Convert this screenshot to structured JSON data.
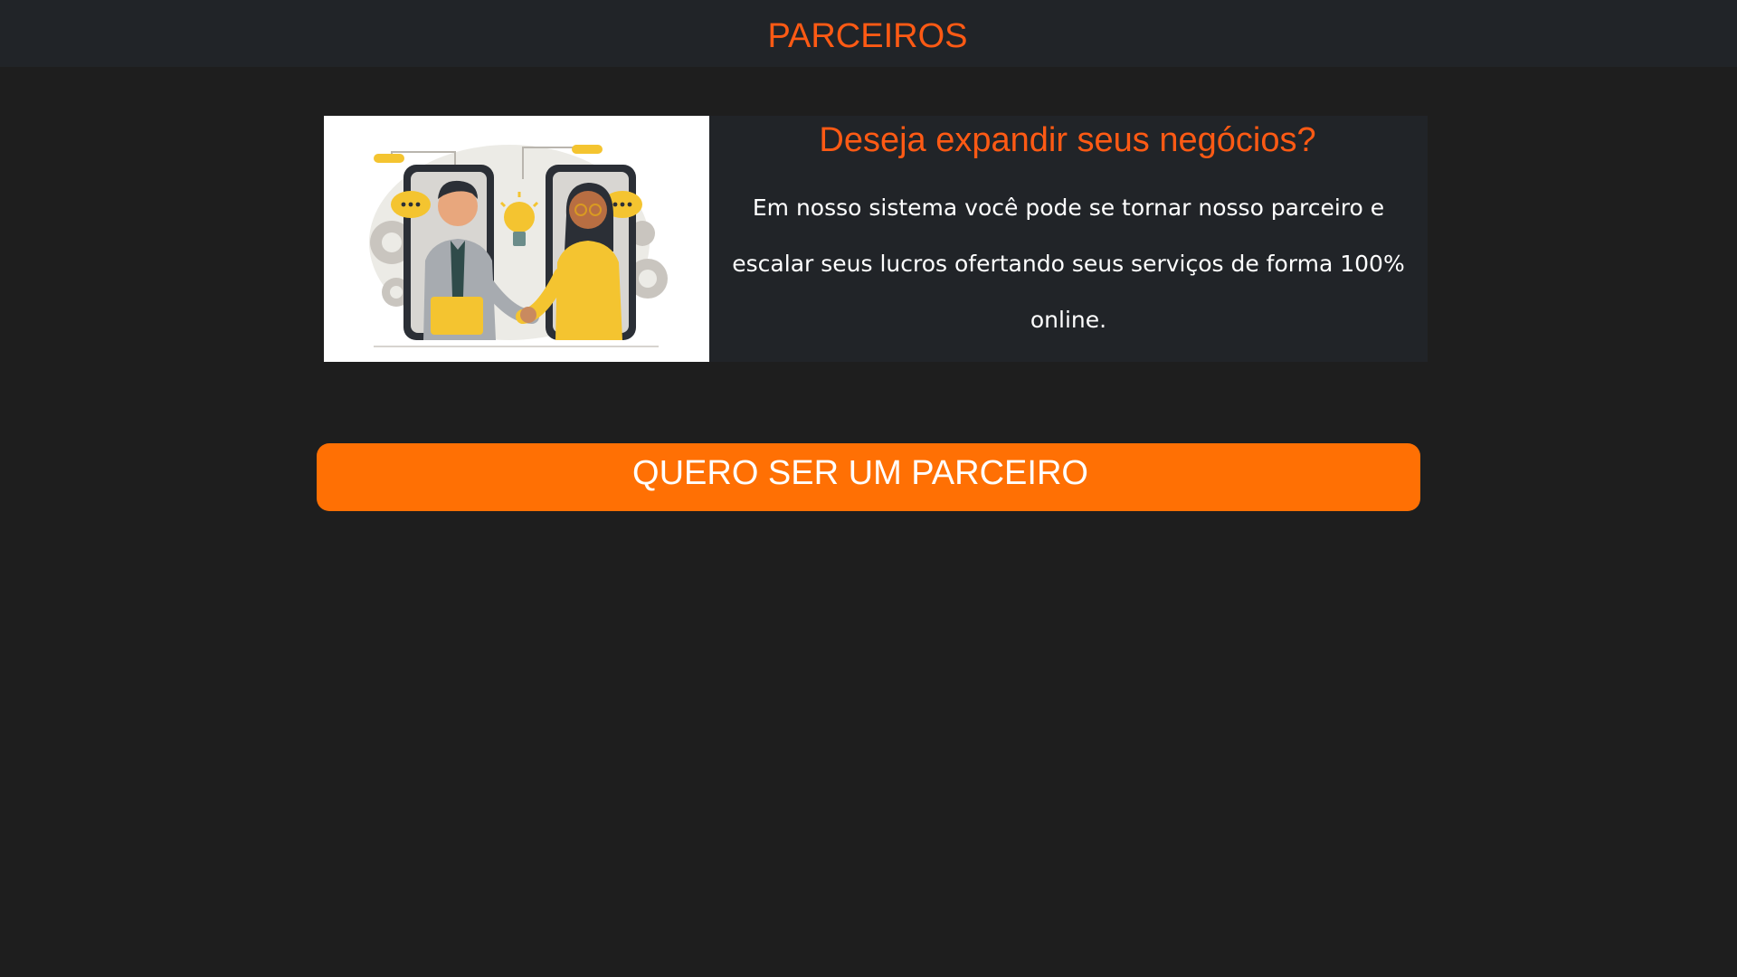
{
  "header": {
    "title": "PARCEIROS"
  },
  "card": {
    "image": {
      "icon": "partners-handshake-illustration"
    },
    "heading": "Deseja expandir seus negócios?",
    "body": "Em nosso sistema você pode se tornar nosso parceiro e escalar seus lucros ofertando seus serviços de forma 100% online."
  },
  "cta": {
    "label": "QUERO SER UM PARCEIRO"
  },
  "colors": {
    "background": "#1e1e1e",
    "panel": "#212428",
    "accent": "#ff5a14",
    "button": "#ff7004",
    "text": "#ffffff"
  }
}
